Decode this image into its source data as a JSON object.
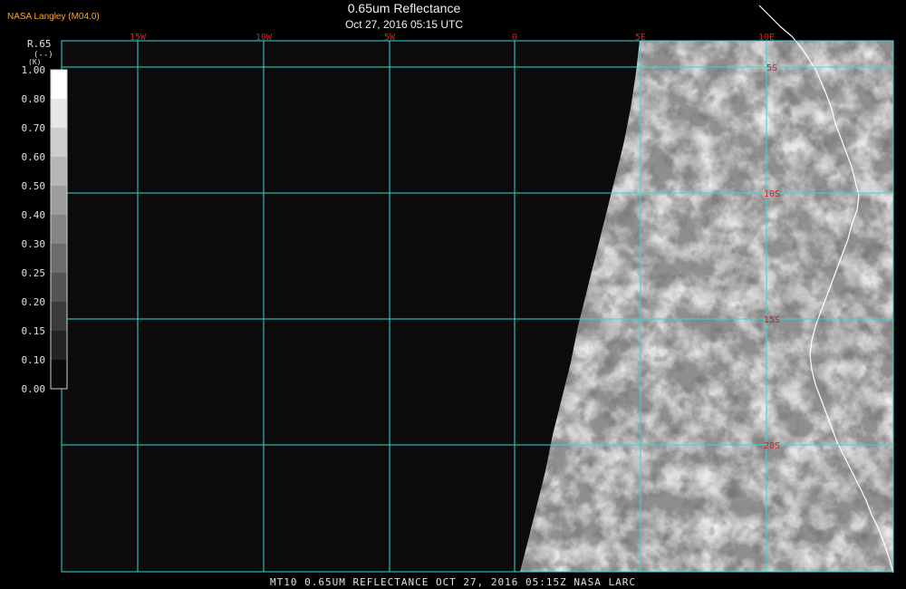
{
  "header": {
    "producer": "NASA Langley (M04.0)",
    "title": "0.65um Reflectance",
    "timestamp": "Oct 27, 2016 05:15 UTC"
  },
  "colorbar": {
    "variable": "R.65",
    "units": "(--)",
    "units_marker": "(K)",
    "ticks": [
      "1.00",
      "0.80",
      "0.70",
      "0.60",
      "0.50",
      "0.40",
      "0.30",
      "0.25",
      "0.20",
      "0.15",
      "0.10",
      "0.00"
    ]
  },
  "longitude_labels": [
    "15W",
    "10W",
    "5W",
    "0",
    "5E",
    "10E"
  ],
  "latitude_labels": [
    "5S",
    "10S",
    "15S",
    "20S"
  ],
  "footer": {
    "text": "MT10  0.65UM REFLECTANCE   OCT 27, 2016 05:15Z   NASA LARC"
  },
  "colors": {
    "gridline": "#33d9d9",
    "coord_label": "#d22222",
    "producer_label": "#ffa626",
    "background": "#000000",
    "space": "#0b0b0b",
    "coastline": "#ffffff"
  }
}
